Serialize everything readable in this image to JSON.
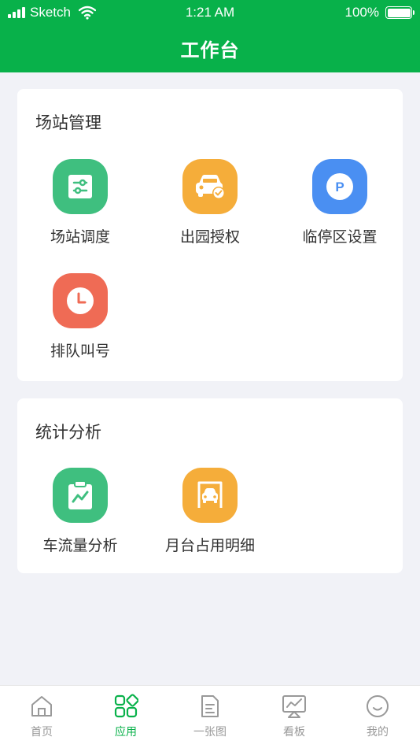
{
  "status": {
    "carrier": "Sketch",
    "time": "1:21 AM",
    "battery": "100%"
  },
  "header": {
    "title": "工作台"
  },
  "sections": [
    {
      "title": "场站管理",
      "items": [
        {
          "label": "场站调度",
          "icon": "sliders-icon",
          "color": "#3fbf7f"
        },
        {
          "label": "出园授权",
          "icon": "car-check-icon",
          "color": "#f5ad3a"
        },
        {
          "label": "临停区设置",
          "icon": "parking-icon",
          "color": "#4a8ff2"
        },
        {
          "label": "排队叫号",
          "icon": "clock-icon",
          "color": "#ef6b55"
        }
      ]
    },
    {
      "title": "统计分析",
      "items": [
        {
          "label": "车流量分析",
          "icon": "clipboard-chart-icon",
          "color": "#3fbf7f"
        },
        {
          "label": "月台占用明细",
          "icon": "garage-car-icon",
          "color": "#f5ad3a"
        }
      ]
    }
  ],
  "tabbar": {
    "items": [
      {
        "label": "首页",
        "icon": "home-icon"
      },
      {
        "label": "应用",
        "icon": "apps-icon",
        "active": true
      },
      {
        "label": "一张图",
        "icon": "map-doc-icon"
      },
      {
        "label": "看板",
        "icon": "dashboard-icon"
      },
      {
        "label": "我的",
        "icon": "smile-icon"
      }
    ],
    "active_color": "#08b14a"
  },
  "theme": {
    "primary": "#08b14a",
    "background": "#f1f2f7"
  }
}
